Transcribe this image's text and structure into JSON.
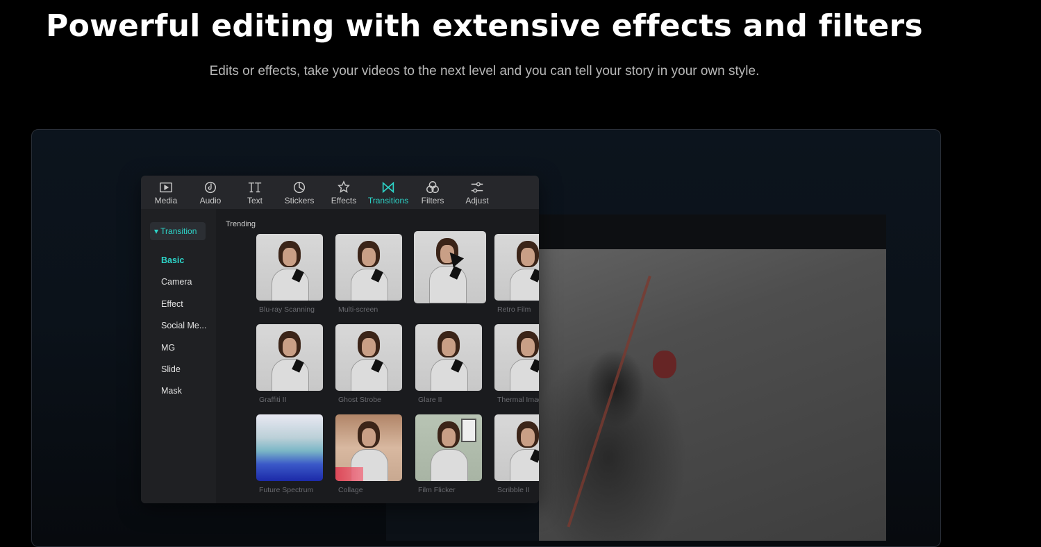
{
  "hero": {
    "title": "Powerful editing with extensive effects and filters",
    "subtitle": "Edits or effects, take your videos to the next level and you can tell your story in your own style."
  },
  "toolbar": {
    "tabs": [
      {
        "label": "Media",
        "icon": "media-icon"
      },
      {
        "label": "Audio",
        "icon": "audio-icon"
      },
      {
        "label": "Text",
        "icon": "text-icon"
      },
      {
        "label": "Stickers",
        "icon": "stickers-icon"
      },
      {
        "label": "Effects",
        "icon": "effects-icon"
      },
      {
        "label": "Transitions",
        "icon": "transitions-icon",
        "active": true
      },
      {
        "label": "Filters",
        "icon": "filters-icon"
      },
      {
        "label": "Adjust",
        "icon": "adjust-icon"
      }
    ]
  },
  "sidebar": {
    "header": "▾ Transition",
    "items": [
      "Basic",
      "Camera",
      "Effect",
      "Social Me...",
      "MG",
      "Slide",
      "Mask"
    ],
    "active_index": 0
  },
  "grid": {
    "section": "Trending",
    "items": [
      {
        "name": "Blu-ray Scanning"
      },
      {
        "name": "Multi-screen"
      },
      {
        "name": ""
      },
      {
        "name": "Retro Film"
      },
      {
        "name": "Graffiti II"
      },
      {
        "name": "Ghost Strobe"
      },
      {
        "name": "Glare II"
      },
      {
        "name": "Thermal Imaging"
      },
      {
        "name": "Future Spectrum"
      },
      {
        "name": "Collage"
      },
      {
        "name": "Film Flicker"
      },
      {
        "name": "Scribble II"
      }
    ]
  },
  "colors": {
    "accent": "#2dd4c8",
    "background": "#000000",
    "panel": "#1a1b1e"
  }
}
